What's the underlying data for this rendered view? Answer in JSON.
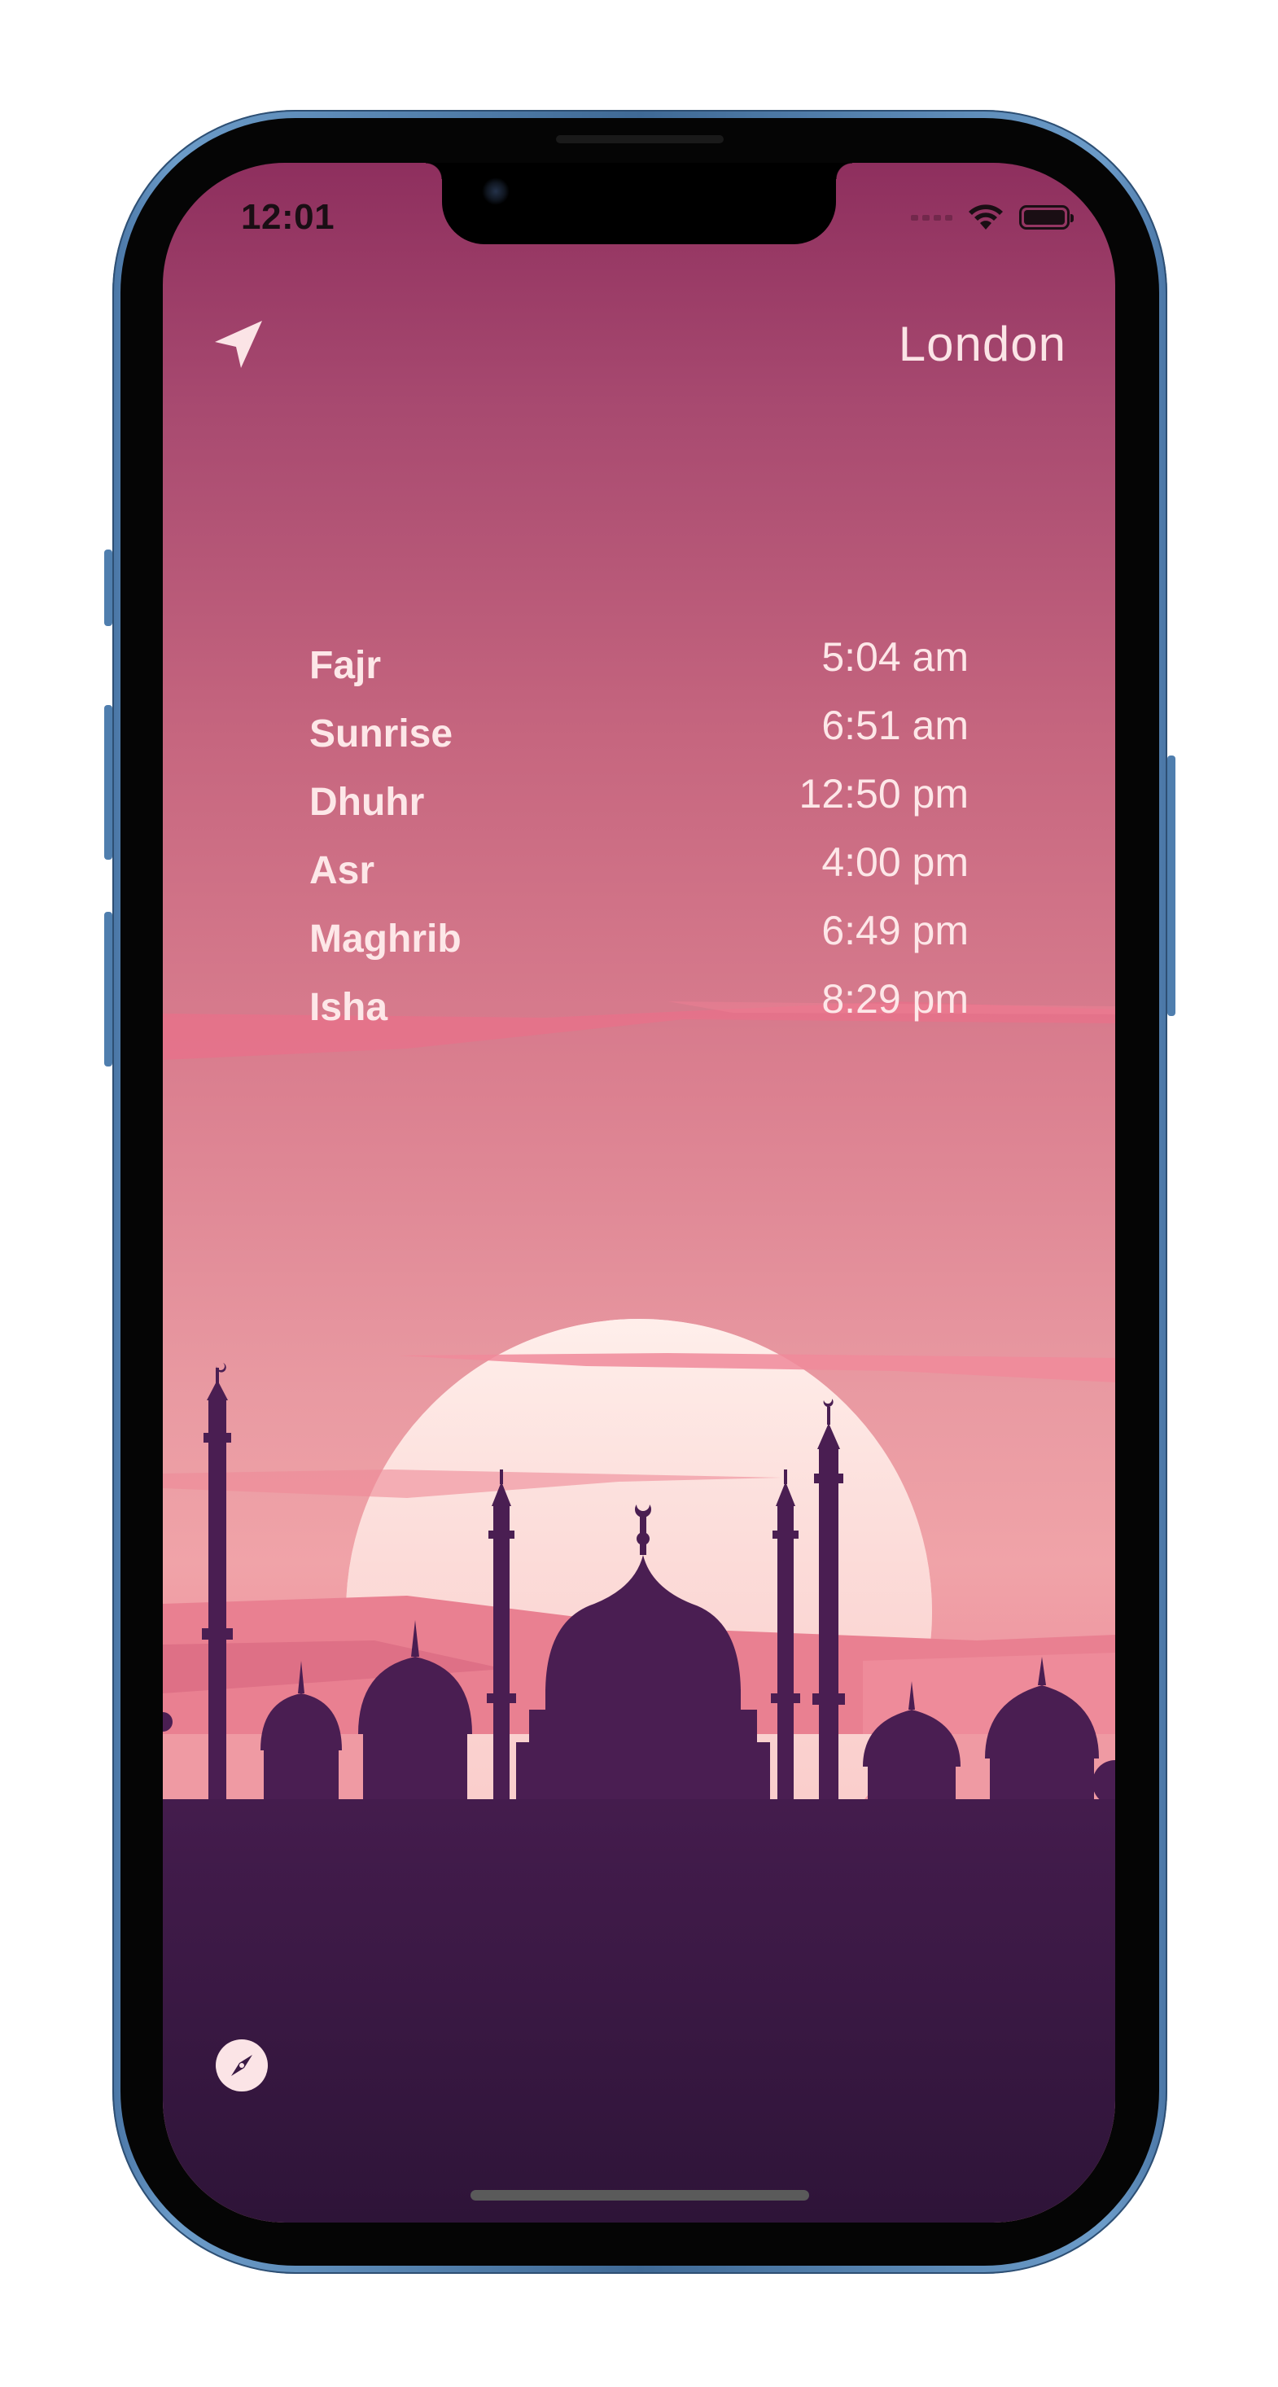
{
  "status_bar": {
    "time": "12:01"
  },
  "header": {
    "location_icon": "location-arrow-icon",
    "city": "London"
  },
  "prayers": [
    {
      "name": "Fajr",
      "time": "5:04 am"
    },
    {
      "name": "Sunrise",
      "time": "6:51 am"
    },
    {
      "name": "Dhuhr",
      "time": "12:50 pm"
    },
    {
      "name": "Asr",
      "time": "4:00 pm"
    },
    {
      "name": "Maghrib",
      "time": "6:49 pm"
    },
    {
      "name": "Isha",
      "time": "8:29 pm"
    }
  ],
  "footer": {
    "compass_icon": "compass-icon"
  },
  "colors": {
    "sky_top": "#8e2f5e",
    "sky_bottom": "#f0a3a8",
    "sun": "#fde3e0",
    "silhouette": "#4a1e52",
    "ground": "#33173f",
    "text": "#fde7e8"
  }
}
